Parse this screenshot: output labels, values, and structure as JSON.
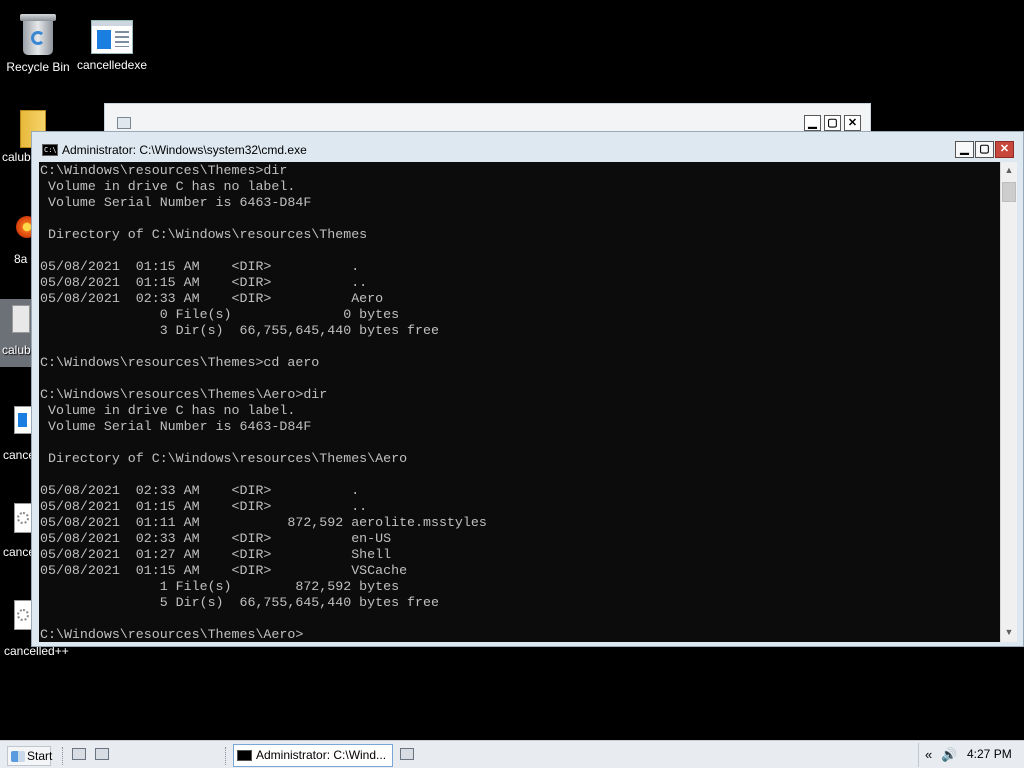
{
  "desktop": {
    "icons": [
      {
        "label": "Recycle Bin",
        "icon": "recycle-bin-icon"
      },
      {
        "label": "cancelledexe",
        "icon": "app-window-icon"
      },
      {
        "label": "calub",
        "icon": "folder-icon"
      },
      {
        "label": "8a",
        "icon": "flower-image-icon"
      },
      {
        "label": "calub",
        "icon": "file-icon"
      },
      {
        "label": "cance",
        "icon": "app-window-icon"
      },
      {
        "label": "cance",
        "icon": "gear-file-icon"
      },
      {
        "label": "cancelled++",
        "icon": "gear-file-icon"
      }
    ]
  },
  "background_window": {
    "buttons": {
      "minimize": "▁",
      "maximize": "▢",
      "close": "✕"
    }
  },
  "cmd_window": {
    "icon_text": "C:\\",
    "title": "Administrator: C:\\Windows\\system32\\cmd.exe",
    "buttons": {
      "minimize": "▁",
      "maximize": "▢",
      "close": "✕"
    },
    "console_text": "C:\\Windows\\resources\\Themes>dir\n Volume in drive C has no label.\n Volume Serial Number is 6463-D84F\n\n Directory of C:\\Windows\\resources\\Themes\n\n05/08/2021  01:15 AM    <DIR>          .\n05/08/2021  01:15 AM    <DIR>          ..\n05/08/2021  02:33 AM    <DIR>          Aero\n               0 File(s)              0 bytes\n               3 Dir(s)  66,755,645,440 bytes free\n\nC:\\Windows\\resources\\Themes>cd aero\n\nC:\\Windows\\resources\\Themes\\Aero>dir\n Volume in drive C has no label.\n Volume Serial Number is 6463-D84F\n\n Directory of C:\\Windows\\resources\\Themes\\Aero\n\n05/08/2021  02:33 AM    <DIR>          .\n05/08/2021  01:15 AM    <DIR>          ..\n05/08/2021  01:11 AM           872,592 aerolite.msstyles\n05/08/2021  02:33 AM    <DIR>          en-US\n05/08/2021  01:27 AM    <DIR>          Shell\n05/08/2021  01:15 AM    <DIR>          VSCache\n               1 File(s)        872,592 bytes\n               5 Dir(s)  66,755,645,440 bytes free\n\nC:\\Windows\\resources\\Themes\\Aero>",
    "scroll": {
      "up": "▲",
      "down": "▼"
    }
  },
  "taskbar": {
    "start_label": "Start",
    "task_label": "Administrator: C:\\Wind...",
    "tray": {
      "chevron": "«",
      "speaker": "🔊",
      "time": "4:27 PM"
    }
  },
  "colors": {
    "console_bg": "#0c0c0c",
    "console_text": "#c0c0c0",
    "window_frame": "#dde8f1",
    "close_button": "#c8473c",
    "taskbar": "#e8ecf0"
  }
}
